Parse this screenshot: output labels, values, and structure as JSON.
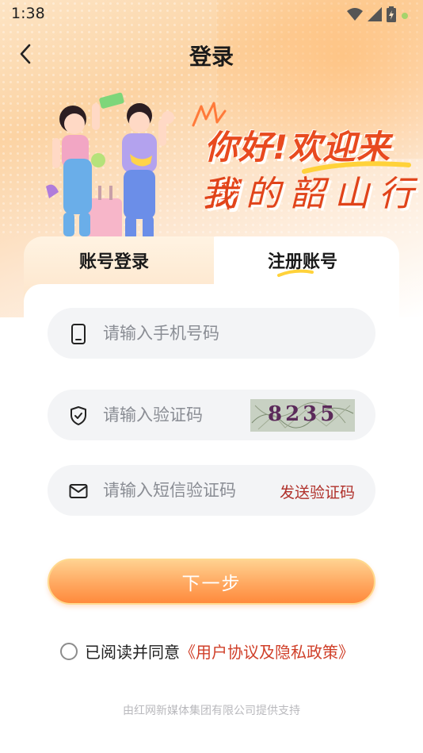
{
  "status_bar": {
    "time": "1:38"
  },
  "header": {
    "title": "登录"
  },
  "banner": {
    "greeting_line1": "你好!欢迎来到",
    "greeting_line2": "我的韶山行"
  },
  "tabs": [
    {
      "label": "账号登录",
      "active": true
    },
    {
      "label": "注册账号",
      "active": false
    }
  ],
  "form": {
    "phone_placeholder": "请输入手机号码",
    "captcha_placeholder": "请输入验证码",
    "captcha_code": "8235",
    "sms_placeholder": "请输入短信验证码",
    "send_code_label": "发送验证码",
    "next_label": "下一步"
  },
  "agreement": {
    "text": "已阅读并同意",
    "link": "《用户协议及隐私政策》",
    "checked": false
  },
  "footer": {
    "text": "由红网新媒体集团有限公司提供支持"
  },
  "colors": {
    "accent": "#ff9a4d",
    "link": "#d0402a",
    "send_code": "#b0302a"
  },
  "icons": [
    "back-arrow-icon",
    "phone-icon",
    "shield-check-icon",
    "mail-icon",
    "wifi-icon",
    "signal-icon",
    "battery-icon"
  ]
}
